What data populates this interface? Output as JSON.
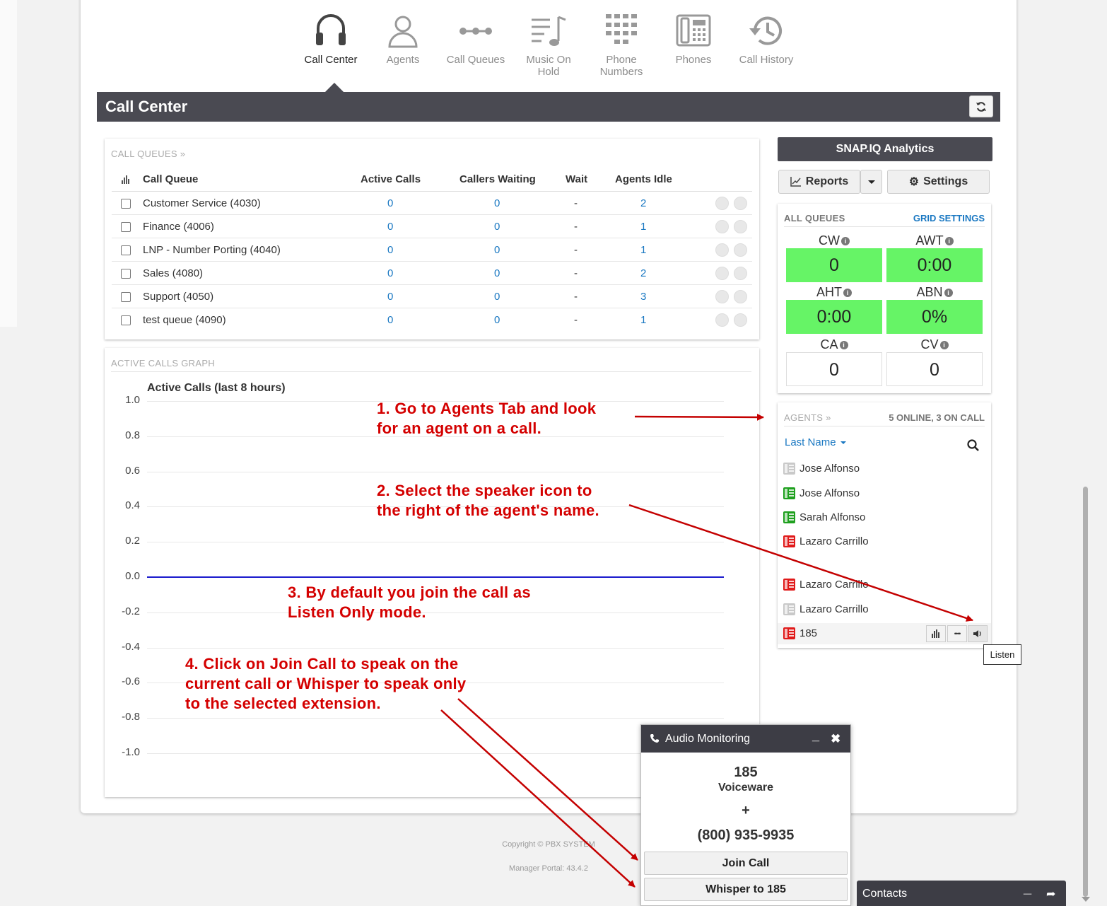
{
  "nav": [
    {
      "label": "Call Center",
      "icon": "headset-icon",
      "active": true
    },
    {
      "label": "Agents",
      "icon": "person-icon"
    },
    {
      "label": "Call Queues",
      "icon": "queue-icon"
    },
    {
      "label": "Music On Hold",
      "icon": "music-icon"
    },
    {
      "label": "Phone Numbers",
      "icon": "dialpad-icon"
    },
    {
      "label": "Phones",
      "icon": "desk-phone-icon"
    },
    {
      "label": "Call History",
      "icon": "history-icon"
    }
  ],
  "header": {
    "title": "Call Center"
  },
  "queues": {
    "title": "CALL QUEUES »",
    "columns": [
      "Call Queue",
      "Active Calls",
      "Callers Waiting",
      "Wait",
      "Agents Idle"
    ],
    "rows": [
      {
        "name": "Customer Service (4030)",
        "active": "0",
        "waiting": "0",
        "wait": "-",
        "idle": "2"
      },
      {
        "name": "Finance (4006)",
        "active": "0",
        "waiting": "0",
        "wait": "-",
        "idle": "1"
      },
      {
        "name": "LNP - Number Porting (4040)",
        "active": "0",
        "waiting": "0",
        "wait": "-",
        "idle": "1"
      },
      {
        "name": "Sales (4080)",
        "active": "0",
        "waiting": "0",
        "wait": "-",
        "idle": "2"
      },
      {
        "name": "Support (4050)",
        "active": "0",
        "waiting": "0",
        "wait": "-",
        "idle": "3"
      },
      {
        "name": "test queue (4090)",
        "active": "0",
        "waiting": "0",
        "wait": "-",
        "idle": "1"
      }
    ]
  },
  "graph": {
    "title": "ACTIVE CALLS GRAPH",
    "chart_title": "Active Calls (last 8 hours)",
    "yticks": [
      "1.0",
      "0.8",
      "0.6",
      "0.4",
      "0.2",
      "0.0",
      "-0.2",
      "-0.4",
      "-0.6",
      "-0.8",
      "-1.0"
    ]
  },
  "chart_data": {
    "type": "line",
    "title": "Active Calls (last 8 hours)",
    "ylim": [
      -1.0,
      1.0
    ],
    "series": [
      {
        "values": [
          0,
          0
        ]
      }
    ],
    "line_color": "#1a1acc"
  },
  "annotations": {
    "a1": [
      "1. Go to Agents Tab and look",
      "for an agent on a call."
    ],
    "a2": [
      "2. Select the speaker icon to",
      "the right of the agent's name."
    ],
    "a3": [
      "3. By default you join the call as",
      "Listen Only mode."
    ],
    "a4": [
      "4. Click on Join Call to speak on the",
      "current call or Whisper to speak only",
      "to the selected extension."
    ]
  },
  "analytics": {
    "button": "SNAP.IQ Analytics",
    "reports": "Reports",
    "settings": "Settings"
  },
  "all_queues": {
    "title": "ALL QUEUES",
    "grid_settings": "GRID SETTINGS",
    "metrics": [
      {
        "label": "CW",
        "value": "0",
        "style": "green"
      },
      {
        "label": "AWT",
        "value": "0:00",
        "style": "green"
      },
      {
        "label": "AHT",
        "value": "0:00",
        "style": "green"
      },
      {
        "label": "ABN",
        "value": "0%",
        "style": "green"
      },
      {
        "label": "CA",
        "value": "0",
        "style": "white"
      },
      {
        "label": "CV",
        "value": "0",
        "style": "white"
      }
    ]
  },
  "agents": {
    "title": "AGENTS »",
    "status": "5 ONLINE, 3 ON CALL",
    "sort": "Last Name",
    "list": [
      {
        "name": "Jose Alfonso",
        "state": "gray"
      },
      {
        "name": "Jose Alfonso",
        "state": "green"
      },
      {
        "name": "Sarah Alfonso",
        "state": "green"
      },
      {
        "name": "Lazaro Carrillo",
        "state": "red"
      },
      {
        "name": "Lazaro Carrillo",
        "state": "red"
      },
      {
        "name": "Lazaro Carrillo",
        "state": "gray"
      },
      {
        "name": "185",
        "state": "red"
      }
    ],
    "tooltip": "Listen"
  },
  "monitor": {
    "title": "Audio Monitoring",
    "ext": "185",
    "name": "Voiceware",
    "plus": "+",
    "number": "(800) 935-9935",
    "join": "Join Call",
    "whisper": "Whisper to 185"
  },
  "footer": {
    "copyright": "Copyright © PBX SYSTEM",
    "version": "Manager Portal: 43.4.2"
  },
  "contacts": {
    "label": "Contacts"
  },
  "colors": {
    "accent": "#1a78c2",
    "header": "#4a4a52",
    "metric_green": "#66f466",
    "annotation": "#d40000"
  }
}
